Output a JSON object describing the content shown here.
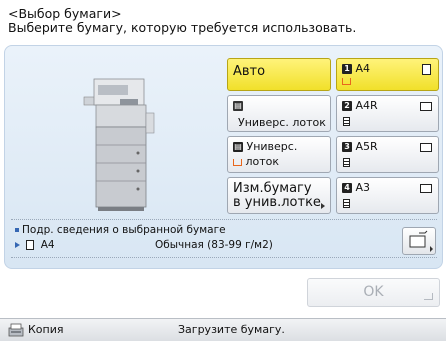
{
  "header": {
    "title": "<Выбор бумаги>",
    "subtitle": "Выберите бумагу, которую требуется использовать."
  },
  "buttons": {
    "auto": {
      "label": "Авто",
      "selected": true
    },
    "bypass_left": {
      "line2": "Универс. лоток"
    },
    "bypass_tray": {
      "line1": "Универс.",
      "line2": "лоток"
    },
    "change_bypass": {
      "line1": "Изм.бумагу",
      "line2": "в унив.лотке"
    },
    "drawer1": {
      "num": "1",
      "size": "A4",
      "selected": true
    },
    "drawer2": {
      "num": "2",
      "size": "A4R"
    },
    "drawer3": {
      "num": "3",
      "size": "A5R"
    },
    "drawer4": {
      "num": "4",
      "size": "A3"
    }
  },
  "info": {
    "details_label": "Подр. сведения о выбранной бумаге",
    "paper_size": "A4",
    "paper_type": "Обычная (83-99 г/м2)"
  },
  "ok_label": "OK",
  "status": {
    "mode": "Копия",
    "message": "Загрузите бумагу."
  },
  "colors": {
    "selected": "#f1e02a",
    "accent": "#3567b3",
    "tray_orange": "#e9661c"
  }
}
